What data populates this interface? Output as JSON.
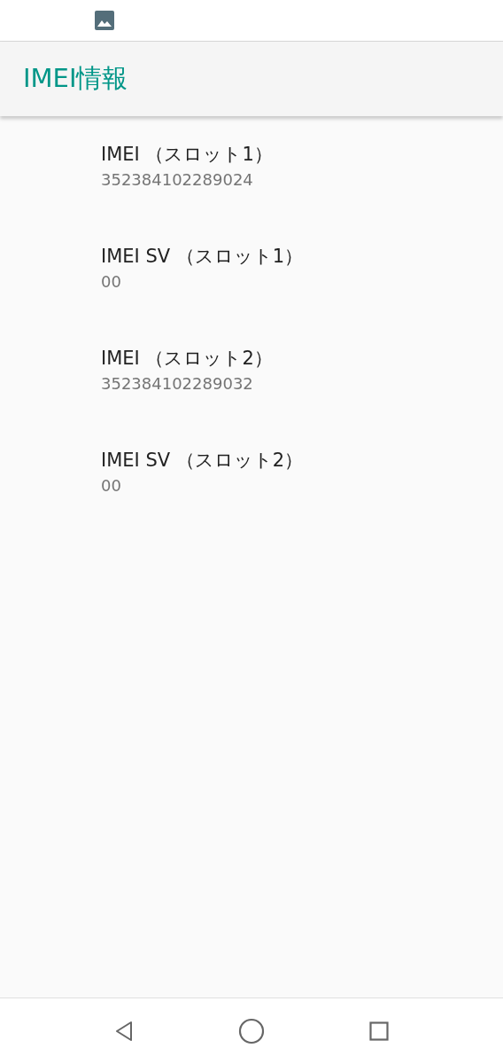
{
  "app_bar": {
    "title": "IMEI情報"
  },
  "items": [
    {
      "title": "IMEI （スロット1）",
      "value": "352384102289024"
    },
    {
      "title": "IMEI SV （スロット1）",
      "value": "00"
    },
    {
      "title": "IMEI （スロット2）",
      "value": "352384102289032"
    },
    {
      "title": "IMEI SV （スロット2）",
      "value": "00"
    }
  ]
}
